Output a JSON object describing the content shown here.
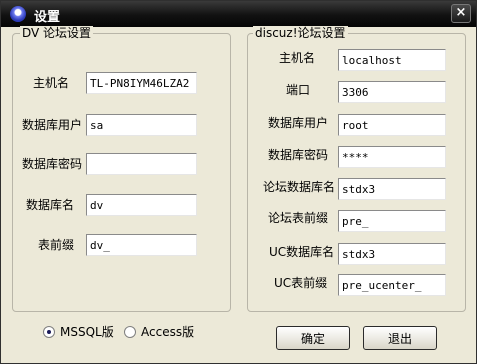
{
  "window": {
    "title": "设置",
    "close_label": "×"
  },
  "dv": {
    "group_title": "DV 论坛设置",
    "fields": [
      {
        "label": "主机名",
        "value": "TL-PN8IYM46LZA2"
      },
      {
        "label": "数据库用户",
        "value": "sa"
      },
      {
        "label": "数据库密码",
        "value": ""
      },
      {
        "label": "数据库名",
        "value": "dv"
      },
      {
        "label": "表前缀",
        "value": "dv_"
      }
    ]
  },
  "discuz": {
    "group_title": "discuz!论坛设置",
    "fields": [
      {
        "label": "主机名",
        "value": "localhost"
      },
      {
        "label": "端口",
        "value": "3306"
      },
      {
        "label": "数据库用户",
        "value": "root"
      },
      {
        "label": "数据库密码",
        "value": "****"
      },
      {
        "label": "论坛数据库名",
        "value": "stdx3"
      },
      {
        "label": "论坛表前缀",
        "value": "pre_"
      },
      {
        "label": "UC数据库名",
        "value": "stdx3"
      },
      {
        "label": "UC表前缀",
        "value": "pre_ucenter_"
      }
    ]
  },
  "db_type": {
    "options": [
      "MSSQL版",
      "Access版"
    ],
    "selected": "MSSQL版"
  },
  "buttons": {
    "ok": "确定",
    "exit": "退出"
  }
}
